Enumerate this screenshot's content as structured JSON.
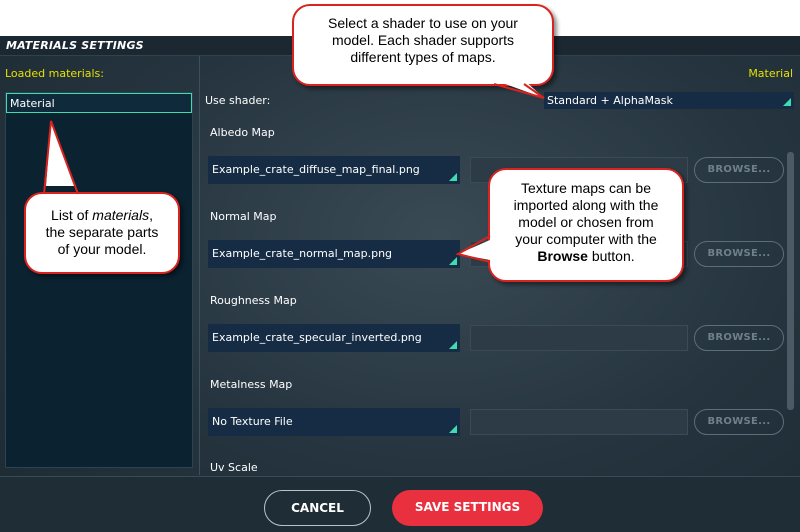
{
  "window": {
    "title": "MATERIALS SETTINGS"
  },
  "left_panel": {
    "label": "Loaded materials:",
    "items": [
      "Material"
    ]
  },
  "right_panel": {
    "header": "Material",
    "shader": {
      "label": "Use shader:",
      "value": "Standard + AlphaMask"
    },
    "maps": [
      {
        "label": "Albedo Map",
        "value": "Example_crate_diffuse_map_final.png",
        "browse": "BROWSE..."
      },
      {
        "label": "Normal Map",
        "value": "Example_crate_normal_map.png",
        "browse": "BROWSE..."
      },
      {
        "label": "Roughness Map",
        "value": "Example_crate_specular_inverted.png",
        "browse": "BROWSE..."
      },
      {
        "label": "Metalness Map",
        "value": "No Texture File",
        "browse": "BROWSE..."
      }
    ],
    "uv_scale_label": "Uv Scale"
  },
  "footer": {
    "cancel": "CANCEL",
    "save": "SAVE SETTINGS"
  },
  "callouts": {
    "shader": [
      "Select a shader to use on your",
      "model. Each shader supports",
      "different types of maps."
    ],
    "materials": {
      "line1_pre": "List of ",
      "line1_em": "materials",
      "line1_post": ",",
      "line2": "the separate parts",
      "line3": "of your model."
    },
    "texture": {
      "line1": "Texture maps can be",
      "line2": "imported along with the",
      "line3": "model or chosen from",
      "line4": "your computer with the",
      "line5_strong": "Browse",
      "line5_post": " button."
    }
  },
  "colors": {
    "accent_yellow": "#e8e000",
    "accent_teal": "#3fdcb0",
    "save_red": "#e8303f",
    "callout_border": "#d8231f"
  }
}
